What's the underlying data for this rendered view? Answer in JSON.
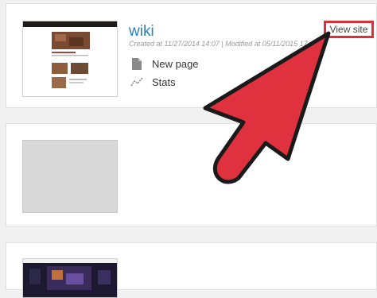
{
  "sites": [
    {
      "title": "wiki",
      "meta": "Created at 11/27/2014 14:07 | Modified at 05/11/2015 17",
      "actions": [
        {
          "label": "New page",
          "icon": "document-icon"
        },
        {
          "label": "Stats",
          "icon": "stats-chart-icon"
        }
      ],
      "view_label": "View site"
    }
  ],
  "colors": {
    "link": "#2a7fc0",
    "highlight": "#d9313b",
    "arrow_fill": "#e0323e",
    "arrow_stroke": "#1a1a1a"
  }
}
